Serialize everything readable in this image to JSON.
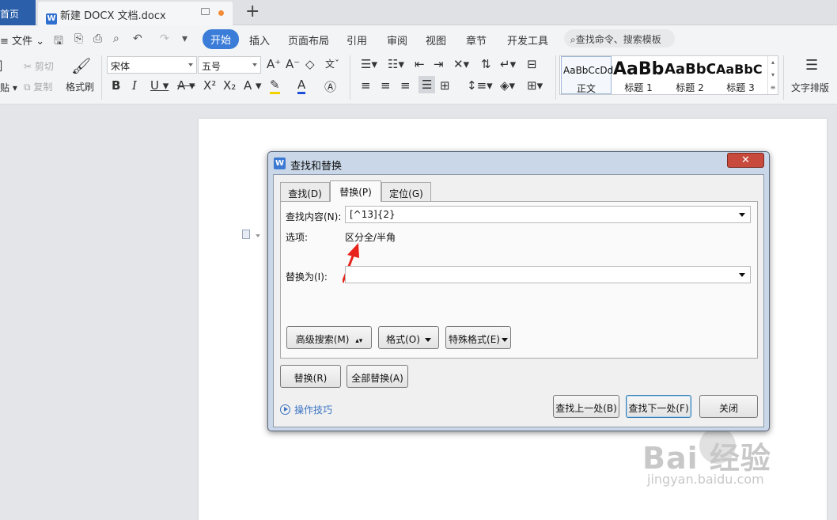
{
  "tabs": {
    "home_label": "首页",
    "doc_title": "新建 DOCX 文档.docx",
    "add_label": "+"
  },
  "menu": {
    "file_label": "文件",
    "tabs": [
      "开始",
      "插入",
      "页面布局",
      "引用",
      "审阅",
      "视图",
      "章节",
      "开发工具"
    ],
    "active_tab": "开始",
    "search_placeholder": "查找命令、搜索模板"
  },
  "ribbon": {
    "paste_label": "粘贴",
    "cut_label": "剪切",
    "copy_label": "复制",
    "format_painter_label": "格式刷",
    "font_name": "宋体",
    "font_size": "五号",
    "styles": [
      {
        "sample": "AaBbCcDd",
        "name": "正文"
      },
      {
        "sample": "AaBb",
        "name": "标题 1"
      },
      {
        "sample": "AaBbC",
        "name": "标题 2"
      },
      {
        "sample": "AaBbC",
        "name": "标题 3"
      }
    ],
    "text_layout_label": "文字排版"
  },
  "dialog": {
    "title": "查找和替换",
    "tabs": [
      "查找(D)",
      "替换(P)",
      "定位(G)"
    ],
    "active_tab": "替换(P)",
    "find_label": "查找内容(N):",
    "find_value": "[^13]{2}",
    "options_label": "选项:",
    "options_value": "区分全/半角",
    "replace_label": "替换为(I):",
    "replace_value": "",
    "advanced_search_label": "高级搜索(M)",
    "format_label": "格式(O)",
    "special_format_label": "特殊格式(E)",
    "replace_button": "替换(R)",
    "replace_all_button": "全部替换(A)",
    "tips_label": "操作技巧",
    "find_prev_button": "查找上一处(B)",
    "find_next_button": "查找下一处(F)",
    "close_button": "关闭"
  },
  "watermark": {
    "brand": "Bai 经验",
    "url": "jingyan.baidu.com"
  },
  "colors": {
    "accent": "#3b7cd8",
    "home_tab": "#2b5faa",
    "close_red": "#c74a3d",
    "annotation_arrow": "#e8231b",
    "link_blue": "#3a73c4"
  }
}
